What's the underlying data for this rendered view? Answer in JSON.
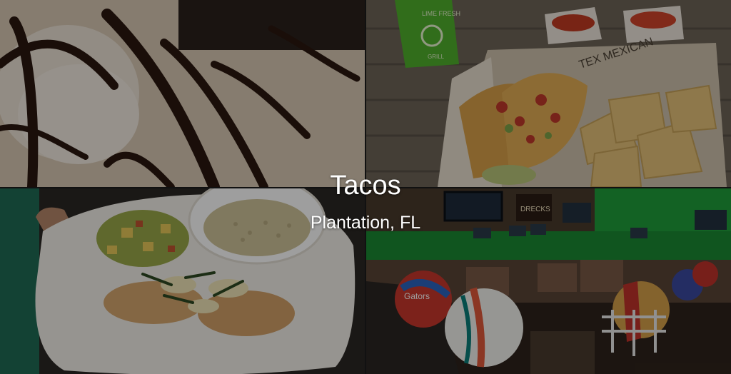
{
  "overlay": {
    "title": "Tacos",
    "subtitle": "Plantation, FL"
  },
  "photos": [
    {
      "subject": "dessert with chocolate drizzle"
    },
    {
      "subject": "tacos with chips and salsa"
    },
    {
      "subject": "grilled chicken with vegetables and couscous"
    },
    {
      "subject": "sports bar interior with football helmets"
    }
  ],
  "scene_text": {
    "cup_text": "LIME FRESH",
    "cup_text_2": "GRILL",
    "paper_text": "TEX MEXICAN",
    "helmet_logo": "Gators",
    "sign_text": "DRECKS"
  },
  "colors": {
    "cup_green": "#4fb02c",
    "bar_green": "#1f9e3a",
    "overlay_dim": "rgba(0,0,0,0.38)"
  }
}
